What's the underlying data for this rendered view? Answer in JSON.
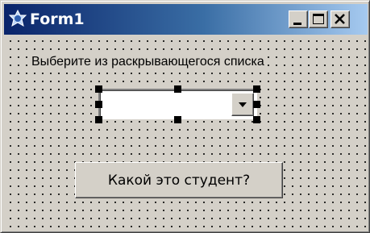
{
  "window": {
    "title": "Form1",
    "icon": "form-icon",
    "controls": [
      "minimize",
      "maximize",
      "close"
    ],
    "colors": {
      "titlebar_start": "#0a246a",
      "titlebar_end": "#a6caf0",
      "face": "#d4d0c8"
    }
  },
  "form": {
    "label_text": "Выберите из раскрывающегося списка",
    "combobox": {
      "value": "",
      "dropdown_icon": "chevron-down-icon",
      "selected_in_designer": true
    },
    "button_label": "Какой это студент?"
  }
}
